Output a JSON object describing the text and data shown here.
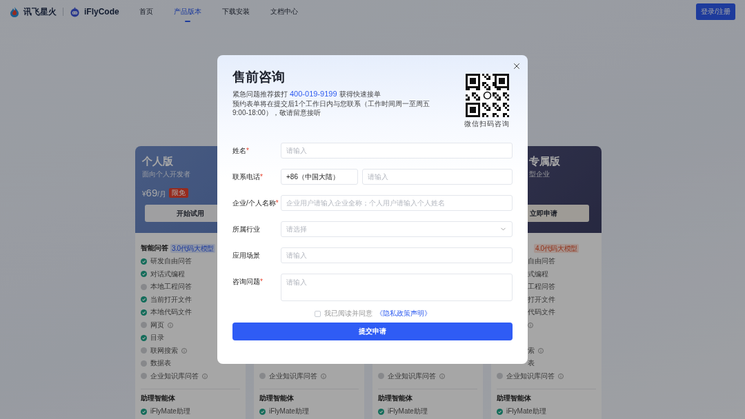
{
  "header": {
    "brand": "讯飞星火",
    "product": "iFlyCode",
    "nav": [
      {
        "label": "首页",
        "selected": false
      },
      {
        "label": "产品版本",
        "selected": true
      },
      {
        "label": "下载安装",
        "selected": false
      },
      {
        "label": "文档中心",
        "selected": false
      }
    ],
    "login": "登录/注册"
  },
  "plans": [
    {
      "kind": "full",
      "title": "个人版",
      "subtitle": "面向个人开发者",
      "price": {
        "currency": "¥",
        "amount": "69",
        "unit": "/月"
      },
      "badge": "限免",
      "action": "开始试用",
      "sections": [
        {
          "heading": "智能问答",
          "tag": "3.0代码大模型",
          "items": [
            {
              "label": "研发自由问答",
              "checked": true
            },
            {
              "label": "对话式编程",
              "checked": true
            },
            {
              "label": "本地工程问答",
              "checked": false
            },
            {
              "label": "当前打开文件",
              "checked": true
            },
            {
              "label": "本地代码文件",
              "checked": true
            },
            {
              "label": "网页",
              "checked": false,
              "info": true
            },
            {
              "label": "目录",
              "checked": true
            },
            {
              "label": "联网搜索",
              "checked": false,
              "info": true
            },
            {
              "label": "数据表",
              "checked": false
            },
            {
              "label": "企业知识库问答",
              "checked": false,
              "info": true
            }
          ]
        },
        {
          "heading": "助理智能体",
          "items": [
            {
              "label": "iFlyMate助理",
              "checked": true
            }
          ]
        }
      ]
    },
    {
      "kind": "bottom",
      "sections": [
        {
          "items": [
            {
              "label": "企业知识库问答",
              "checked": false,
              "info": true
            }
          ]
        },
        {
          "heading": "助理智能体",
          "items": [
            {
              "label": "iFlyMate助理",
              "checked": true
            }
          ]
        }
      ]
    },
    {
      "kind": "bottom",
      "sections": [
        {
          "items": [
            {
              "label": "企业知识库问答",
              "checked": false,
              "info": true
            }
          ]
        },
        {
          "heading": "助理智能体",
          "items": [
            {
              "label": "iFlyMate助理",
              "checked": true
            }
          ]
        }
      ]
    },
    {
      "kind": "right",
      "title": "专属版",
      "subtitle": "型企业",
      "action": "立即申请",
      "sections": [
        {
          "tag": "4.0代码大模型",
          "items": [
            {
              "kind": "fragment",
              "label": "自由问答"
            },
            {
              "kind": "fragment",
              "label": "式编程"
            },
            {
              "kind": "fragment",
              "label": "工程问答"
            },
            {
              "kind": "fragment",
              "label": "打开文件"
            },
            {
              "kind": "fragment",
              "label": "代码文件"
            },
            {
              "kind": "fragment",
              "info": true
            },
            {
              "kind": "blank"
            },
            {
              "kind": "fragment",
              "label": "索",
              "info": true
            },
            {
              "kind": "fragment",
              "label": "表"
            },
            {
              "label": "企业知识库问答",
              "checked": false,
              "info": true
            }
          ]
        },
        {
          "heading": "助理智能体",
          "items": [
            {
              "label": "iFlyMate助理",
              "checked": true
            }
          ]
        }
      ]
    }
  ],
  "modal": {
    "title": "售前咨询",
    "notice": {
      "prefix": "紧急问题推荐拨打",
      "phone": "400-019-9199",
      "suffix": "获得快速接单"
    },
    "description": "预约表单将在提交后1个工作日内与您联系（工作时间周一至周五9:00-18:00），敬请留意接听",
    "qr_caption": "微信扫码咨询",
    "form": {
      "required_mark": "*",
      "fields": [
        {
          "kind": "input",
          "label": "姓名",
          "required": true,
          "placeholder": "请输入"
        },
        {
          "kind": "phone",
          "label": "联系电话",
          "required": true,
          "code": "+86（中国大陆）",
          "placeholder": "请输入"
        },
        {
          "kind": "input",
          "label": "企业/个人名称",
          "required": true,
          "placeholder": "企业用户请输入企业全称；个人用户请输入个人姓名"
        },
        {
          "kind": "select",
          "label": "所属行业",
          "required": false,
          "placeholder": "请选择"
        },
        {
          "kind": "input",
          "label": "应用场景",
          "required": false,
          "placeholder": "请输入"
        },
        {
          "kind": "textarea",
          "label": "咨询问题",
          "required": true,
          "placeholder": "请输入"
        }
      ],
      "agree": {
        "checked": false,
        "text": "我已阅读并同意",
        "link": "《隐私政策声明》"
      },
      "submit": "提交申请"
    }
  }
}
